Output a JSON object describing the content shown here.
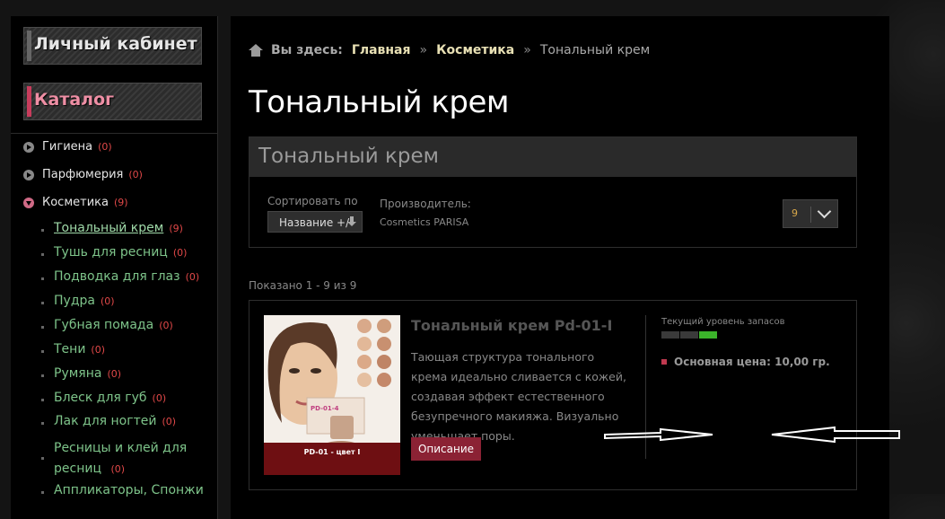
{
  "sidebar": {
    "account_title": "Личный кабинет",
    "catalog_title": "Каталог",
    "categories": [
      {
        "label": "Гигиена",
        "count": "(0)"
      },
      {
        "label": "Парфюмерия",
        "count": "(0)"
      },
      {
        "label": "Косметика",
        "count": "(9)"
      }
    ],
    "subcategories": [
      {
        "label": "Тональный крем",
        "count": "(9)"
      },
      {
        "label": "Тушь для ресниц",
        "count": "(0)"
      },
      {
        "label": "Подводка для глаз",
        "count": "(0)"
      },
      {
        "label": "Пудра",
        "count": "(0)"
      },
      {
        "label": "Губная помада",
        "count": "(0)"
      },
      {
        "label": "Тени",
        "count": "(0)"
      },
      {
        "label": "Румяна",
        "count": "(0)"
      },
      {
        "label": "Блеск для губ",
        "count": "(0)"
      },
      {
        "label": "Лак для ногтей",
        "count": "(0)"
      },
      {
        "label": "Ресницы и клей для ресниц",
        "count": "(0)"
      },
      {
        "label": "Аппликаторы, Спонжи"
      }
    ]
  },
  "breadcrumb": {
    "label": "Вы здесь:",
    "items": [
      "Главная",
      "Косметика"
    ],
    "separator": "»",
    "current": "Тональный крем"
  },
  "page_title": "Тональный крем",
  "category": {
    "heading": "Тональный крем",
    "sort_label": "Сортировать по",
    "sort_value": "Название +/-",
    "manufacturer_label": "Производитель:",
    "manufacturer_value": "Cosmetics PARISA",
    "limit": "9"
  },
  "results": "Показано 1 - 9 из 9",
  "product": {
    "title": "Тональный крем Pd-01-I",
    "description": "Тающая структура тонального крема идеально сливается с кожей, создавая эффект естественного безупречного макияжа. Визуально уменьшает поры.",
    "button": "Описание",
    "stock_label": "Текущий уровень запасов",
    "stock_level": 1.0,
    "price": "Основная цена: 10,00 гр.",
    "image_text": {
      "code": "PD-01 - цвет I",
      "box_label": "PD-01-4"
    }
  }
}
